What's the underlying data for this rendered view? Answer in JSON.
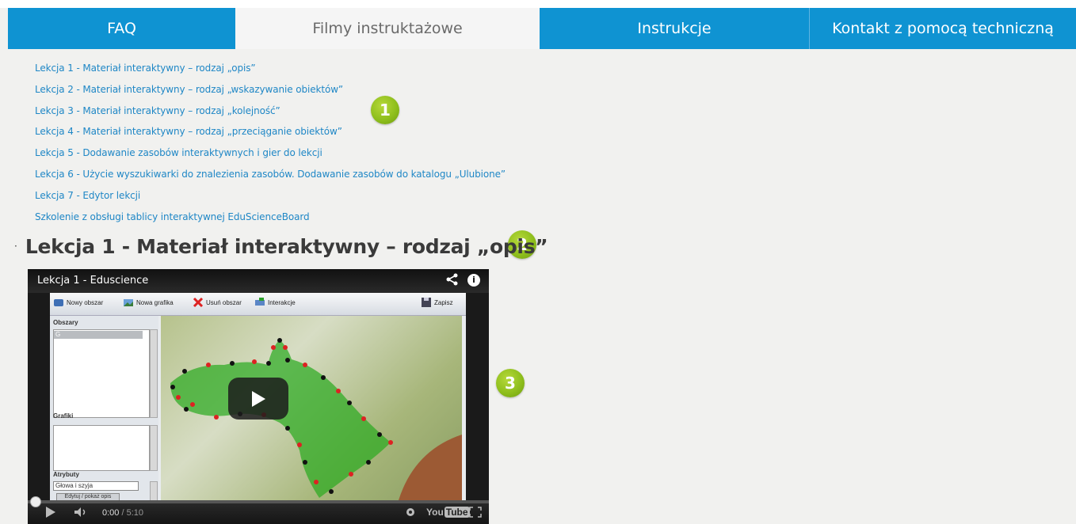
{
  "tabs": [
    {
      "label": "FAQ",
      "active": false
    },
    {
      "label": "Filmy instruktażowe",
      "active": true
    },
    {
      "label": "Instrukcje",
      "active": false
    },
    {
      "label": "Kontakt z pomocą techniczną",
      "active": false
    }
  ],
  "lessons": [
    "Lekcja 1 - Materiał interaktywny – rodzaj „opis”",
    "Lekcja 2 - Materiał interaktywny – rodzaj „wskazywanie obiektów”",
    "Lekcja 3 - Materiał interaktywny – rodzaj „kolejność”",
    "Lekcja 4 - Materiał interaktywny – rodzaj „przeciąganie obiektów”",
    "Lekcja 5 - Dodawanie zasobów interaktywnych i gier do lekcji",
    "Lekcja 6 - Użycie wyszukiwarki do znalezienia zasobów. Dodawanie zasobów do katalogu „Ulubione”",
    "Lekcja 7 - Edytor lekcji",
    "Szkolenie z obsługi tablicy interaktywnej EduScienceBoard"
  ],
  "badges": {
    "b1": "1",
    "b2": "2",
    "b3": "3"
  },
  "section": {
    "bullet": "·",
    "title": "Lekcja 1 - Materiał interaktywny – rodzaj „opis”"
  },
  "video": {
    "title": "Lekcja 1 - Eduscience",
    "info": "i",
    "time_current": "0:00",
    "time_total": " / 5:10",
    "progress": 0,
    "toolbar": {
      "new_area": "Nowy obszar",
      "new_graphic": "Nowa grafika",
      "delete_area": "Usuń obszar",
      "interactions": "Interakcje",
      "save": "Zapisz"
    },
    "sidebar": {
      "areas_label": "Obszary",
      "areas_item": "G",
      "graphics_label": "Grafiki",
      "attributes_label": "Atrybuty",
      "attribute_value": "Głowa i szyja",
      "edit_button": "Edytuj / pokaż opis"
    },
    "youtube": {
      "you": "You",
      "tube": "Tube"
    }
  },
  "colors": {
    "tab_blue": "#0f93d2",
    "link_blue": "#1f87c6",
    "badge_green": "#8fbf1d"
  }
}
